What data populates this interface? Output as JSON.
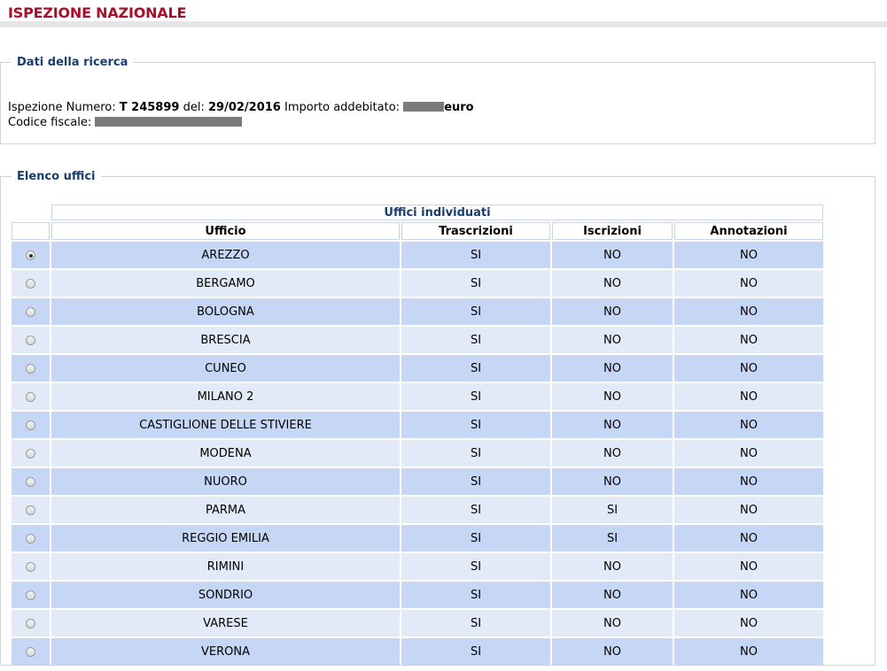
{
  "header": {
    "title": "ISPEZIONE NAZIONALE"
  },
  "search_section": {
    "legend": "Dati della ricerca",
    "number_label": "Ispezione Numero:",
    "number_value": "T 245899",
    "date_label": "del:",
    "date_value": "29/02/2016",
    "amount_label": "Importo addebitato:",
    "amount_unit": "euro",
    "fiscal_code_label": "Codice fiscale:"
  },
  "offices_section": {
    "legend": "Elenco uffici",
    "caption": "Uffici individuati",
    "columns": [
      "Ufficio",
      "Trascrizioni",
      "Iscrizioni",
      "Annotazioni"
    ],
    "rows": [
      {
        "ufficio": "AREZZO",
        "trascrizioni": "SI",
        "iscrizioni": "NO",
        "annotazioni": "NO",
        "selected": true
      },
      {
        "ufficio": "BERGAMO",
        "trascrizioni": "SI",
        "iscrizioni": "NO",
        "annotazioni": "NO",
        "selected": false
      },
      {
        "ufficio": "BOLOGNA",
        "trascrizioni": "SI",
        "iscrizioni": "NO",
        "annotazioni": "NO",
        "selected": false
      },
      {
        "ufficio": "BRESCIA",
        "trascrizioni": "SI",
        "iscrizioni": "NO",
        "annotazioni": "NO",
        "selected": false
      },
      {
        "ufficio": "CUNEO",
        "trascrizioni": "SI",
        "iscrizioni": "NO",
        "annotazioni": "NO",
        "selected": false
      },
      {
        "ufficio": "MILANO 2",
        "trascrizioni": "SI",
        "iscrizioni": "NO",
        "annotazioni": "NO",
        "selected": false
      },
      {
        "ufficio": "CASTIGLIONE DELLE STIVIERE",
        "trascrizioni": "SI",
        "iscrizioni": "NO",
        "annotazioni": "NO",
        "selected": false
      },
      {
        "ufficio": "MODENA",
        "trascrizioni": "SI",
        "iscrizioni": "NO",
        "annotazioni": "NO",
        "selected": false
      },
      {
        "ufficio": "NUORO",
        "trascrizioni": "SI",
        "iscrizioni": "NO",
        "annotazioni": "NO",
        "selected": false
      },
      {
        "ufficio": "PARMA",
        "trascrizioni": "SI",
        "iscrizioni": "SI",
        "annotazioni": "NO",
        "selected": false
      },
      {
        "ufficio": "REGGIO EMILIA",
        "trascrizioni": "SI",
        "iscrizioni": "SI",
        "annotazioni": "NO",
        "selected": false
      },
      {
        "ufficio": "RIMINI",
        "trascrizioni": "SI",
        "iscrizioni": "NO",
        "annotazioni": "NO",
        "selected": false
      },
      {
        "ufficio": "SONDRIO",
        "trascrizioni": "SI",
        "iscrizioni": "NO",
        "annotazioni": "NO",
        "selected": false
      },
      {
        "ufficio": "VARESE",
        "trascrizioni": "SI",
        "iscrizioni": "NO",
        "annotazioni": "NO",
        "selected": false
      },
      {
        "ufficio": "VERONA",
        "trascrizioni": "SI",
        "iscrizioni": "NO",
        "annotazioni": "NO",
        "selected": false
      }
    ]
  },
  "colors": {
    "title": "#a8102a",
    "legend": "#173e6e",
    "row_odd": "#c6d7f6",
    "row_even": "#e2eaf7"
  }
}
